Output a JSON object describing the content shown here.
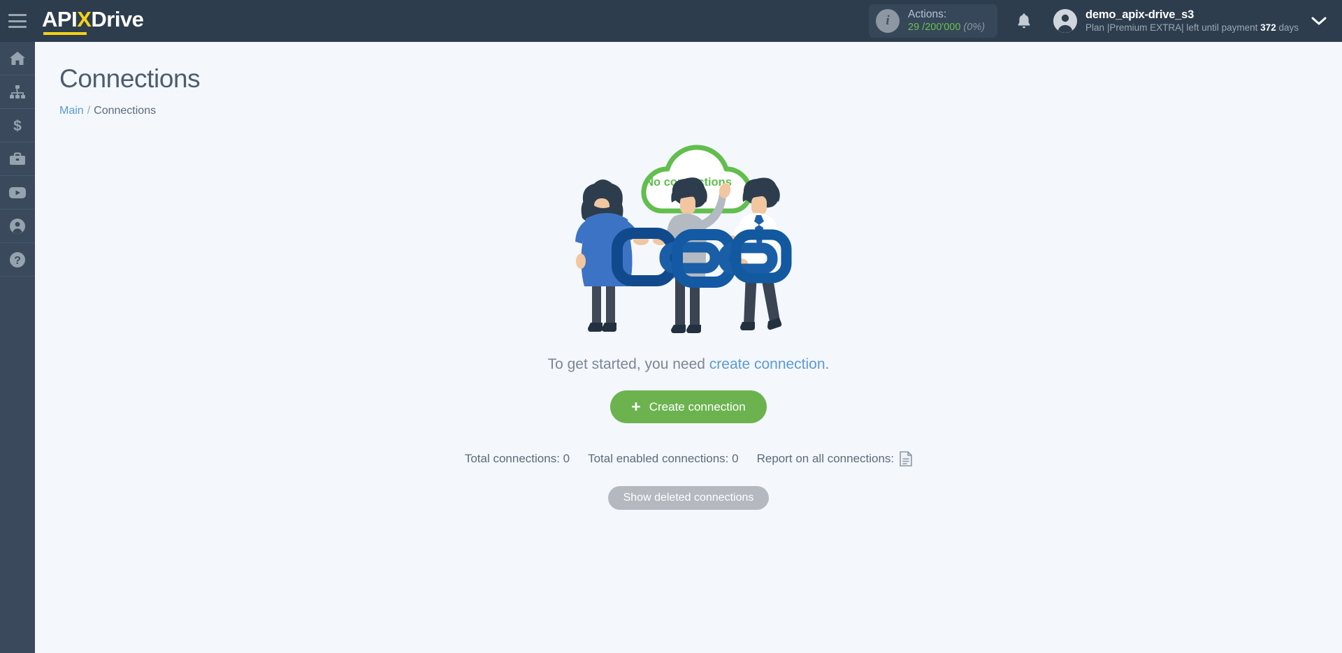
{
  "topbar": {
    "menu_icon": "hamburger-icon",
    "logo": {
      "part1": "API",
      "x": "X",
      "part2": "Drive"
    },
    "actions": {
      "info_icon": "info-icon",
      "label": "Actions:",
      "used": "29",
      "separator": "/",
      "total": "200'000",
      "percent": "(0%)"
    },
    "bell_icon": "bell-icon",
    "user": {
      "avatar_icon": "user-avatar-icon",
      "name": "demo_apix-drive_s3",
      "plan_prefix": "Plan |Premium EXTRA| left until payment",
      "plan_days": "372",
      "plan_suffix": "days"
    },
    "caret_icon": "chevron-down-icon"
  },
  "sidebar": {
    "items": [
      {
        "icon": "home-icon",
        "name": "sidebar-item-home"
      },
      {
        "icon": "sitemap-icon",
        "name": "sidebar-item-connections"
      },
      {
        "icon": "dollar-icon",
        "name": "sidebar-item-billing"
      },
      {
        "icon": "briefcase-icon",
        "name": "sidebar-item-business"
      },
      {
        "icon": "youtube-icon",
        "name": "sidebar-item-video"
      },
      {
        "icon": "account-icon",
        "name": "sidebar-item-account"
      },
      {
        "icon": "help-icon",
        "name": "sidebar-item-help"
      }
    ]
  },
  "page": {
    "title": "Connections",
    "breadcrumb": {
      "root": "Main",
      "separator": "/",
      "current": "Connections"
    }
  },
  "empty_state": {
    "cloud_label": "No connections",
    "hint_prefix": "To get started, you need ",
    "hint_link": "create connection",
    "hint_suffix": ".",
    "create_button": "Create connection",
    "create_plus": "+"
  },
  "stats": {
    "total_connections": "Total connections: 0",
    "total_enabled": "Total enabled connections: 0",
    "report_label": "Report on all connections:",
    "report_icon": "document-icon"
  },
  "footer_actions": {
    "show_deleted": "Show deleted connections"
  },
  "colors": {
    "topbar_bg": "#2e3d4d",
    "sidebar_bg": "#3a4a5c",
    "page_bg": "#f4f7fb",
    "accent_green": "#6cb350",
    "accent_yellow": "#f7d117",
    "link_blue": "#5b9bd5",
    "gray_button": "#b3b9bf"
  }
}
